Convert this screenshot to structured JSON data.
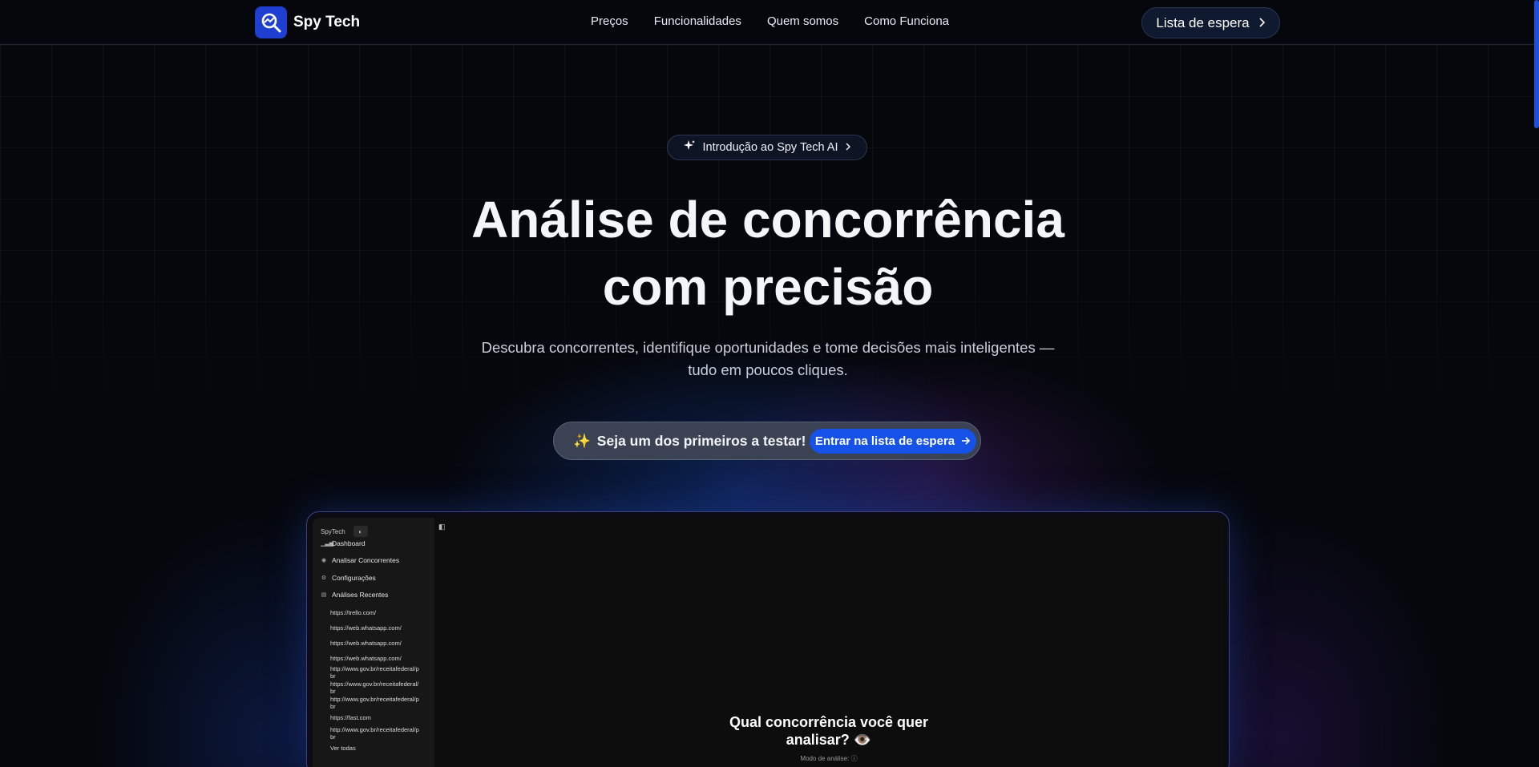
{
  "brand": {
    "name": "Spy Tech",
    "accent": "#1e3fd1"
  },
  "nav": {
    "items": [
      "Preços",
      "Funcionalidades",
      "Quem somos",
      "Como Funciona"
    ]
  },
  "header": {
    "waitlist_label": "Lista de espera"
  },
  "hero": {
    "pill_label": "Introdução ao Spy Tech AI",
    "title_line1": "Análise de concorrência",
    "title_line2": "com precisão",
    "subtitle_line1": "Descubra concorrentes, identifique oportunidades e tome decisões mais inteligentes —",
    "subtitle_line2": "tudo em poucos cliques.",
    "cta_text": "Seja um dos primeiros a testar!",
    "cta_button": "Entrar na lista de espera"
  },
  "preview": {
    "brand": "SpyTech",
    "menu": [
      "Dashboard",
      "Analisar Concorrentes",
      "Configurações",
      "Análises Recentes"
    ],
    "recent": [
      "https://trello.com/",
      "https://web.whatsapp.com/",
      "https://web.whatsapp.com/",
      "https://web.whatsapp.com/",
      "http://www.gov.br/receitafederal/p",
      "br",
      "https://www.gov.br/receitafederal/",
      "br",
      "http://www.gov.br/receitafederal/p",
      "br",
      "https://fast.com",
      "http://www.gov.br/receitafederal/p",
      "br"
    ],
    "see_all": "Ver todas",
    "question_line1": "Qual concorrência você quer",
    "question_line2": "analisar? 👁️",
    "mode_label": "Modo de análise:"
  }
}
